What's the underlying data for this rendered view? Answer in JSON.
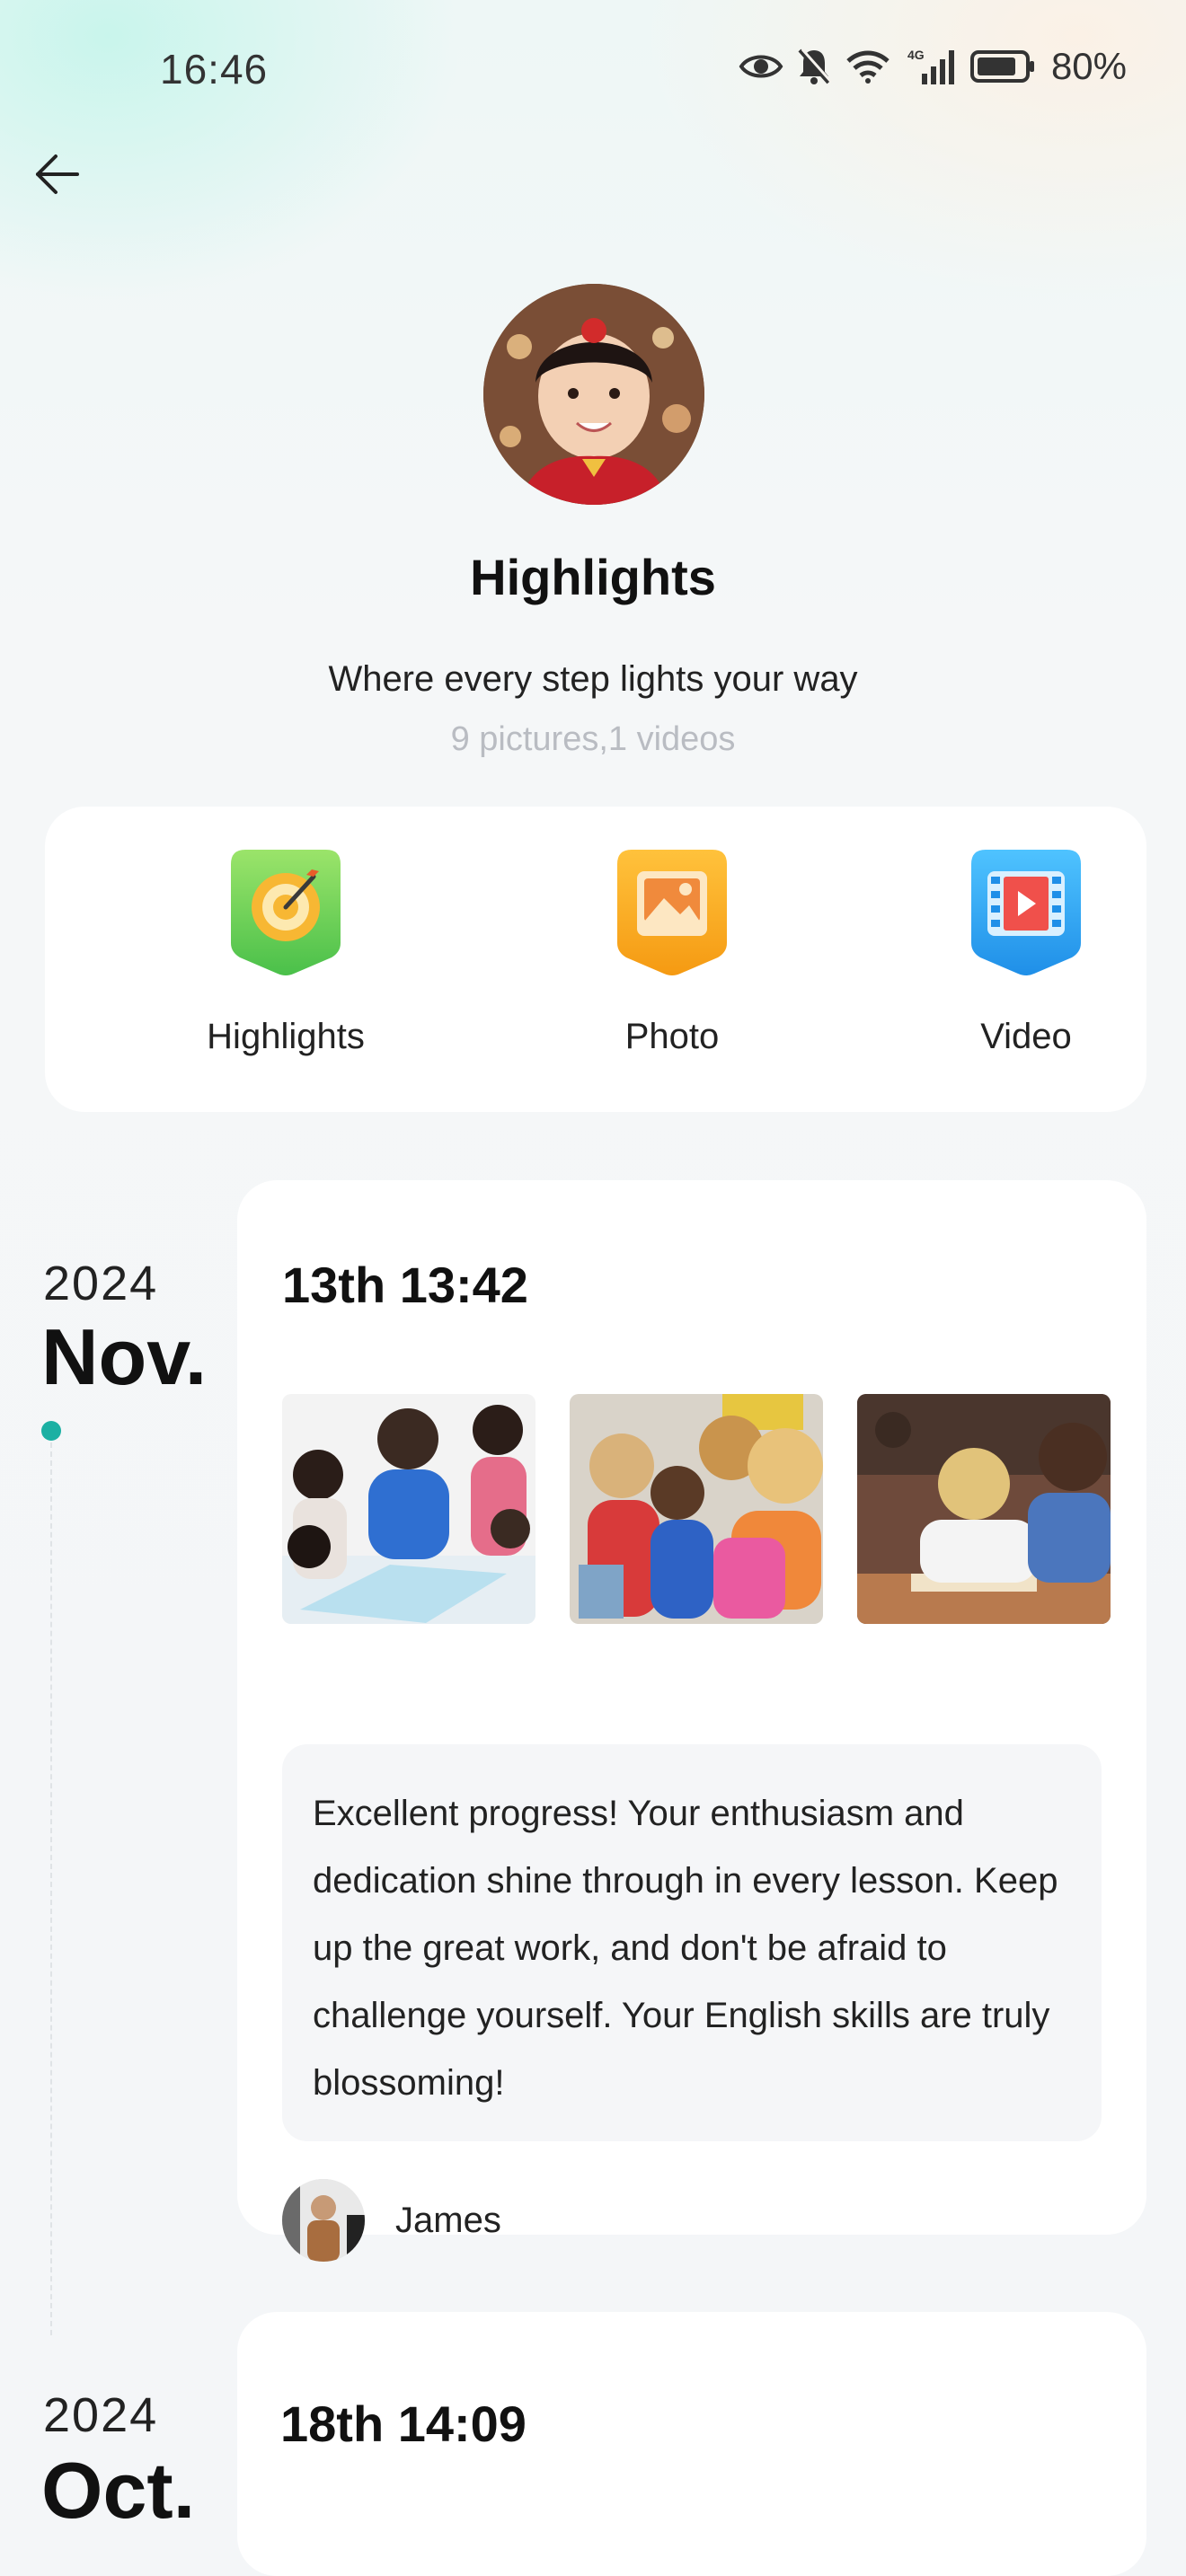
{
  "status_bar": {
    "time": "16:46",
    "network": "4G",
    "battery": "80%",
    "icons": [
      "eye-icon",
      "mute-bell-icon",
      "wifi-icon",
      "signal-icon",
      "battery-icon"
    ]
  },
  "header": {
    "back_icon": "back-arrow-icon",
    "title": "Highlights",
    "subtitle": "Where every step lights your way",
    "count": "9 pictures,1 videos"
  },
  "categories": [
    {
      "label": "Highlights",
      "icon": "target-icon",
      "color": "#7ed957"
    },
    {
      "label": "Photo",
      "icon": "photo-icon",
      "color": "#f7a21b"
    },
    {
      "label": "Video",
      "icon": "video-icon",
      "color": "#2fa8f2"
    }
  ],
  "timeline": [
    {
      "year": "2024",
      "month": "Nov.",
      "datetime": "13th 13:42",
      "photos": [
        "classroom-photo",
        "classroom-photo",
        "classroom-photo"
      ],
      "comment": "Excellent progress! Your enthusiasm and dedication shine through in every lesson. Keep up the great work, and don't be afraid to challenge yourself. Your English skills are truly blossoming!",
      "teacher": "James"
    },
    {
      "year": "2024",
      "month": "Oct.",
      "datetime": "18th 14:09"
    }
  ],
  "colors": {
    "accent": "#1bb0a3",
    "card": "#ffffff",
    "muted_text": "#b9bcc2"
  }
}
